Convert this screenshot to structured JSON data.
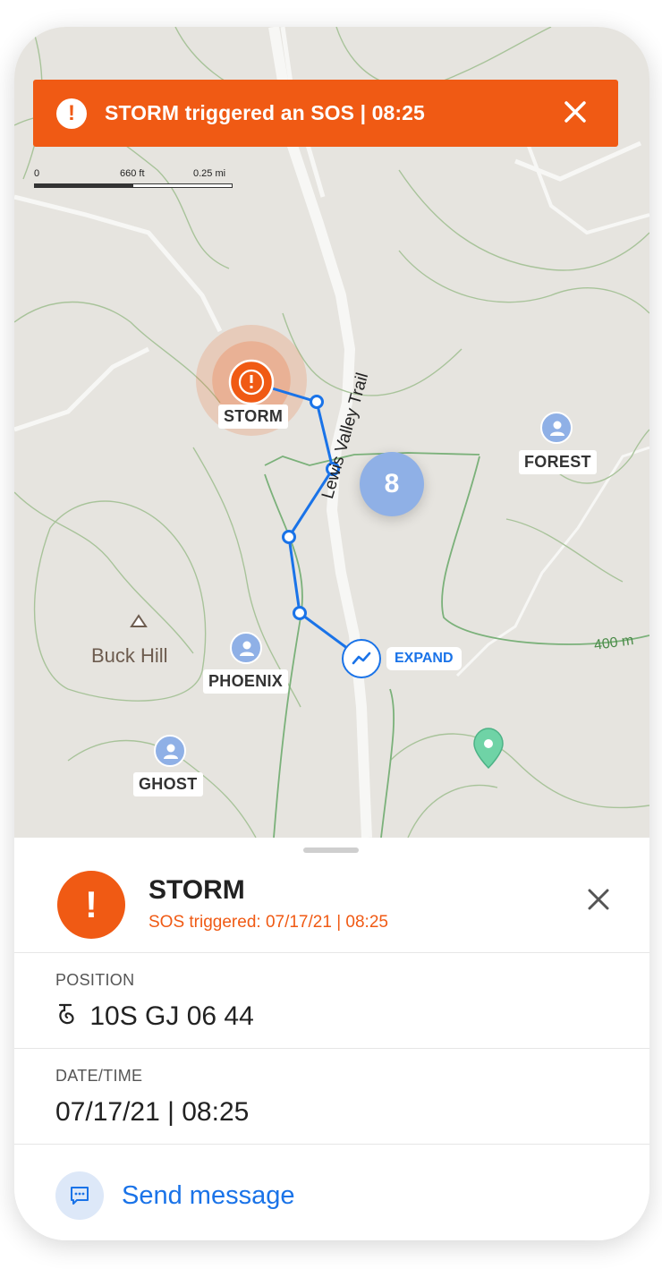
{
  "banner": {
    "text": "STORM triggered an SOS | 08:25",
    "icon": "alert-icon",
    "close_icon": "close-icon",
    "color": "#f05a14"
  },
  "scale_bar": {
    "start": "0",
    "mid": "660 ft",
    "end": "0.25 mi"
  },
  "map": {
    "trail_label": "Lewis Valley Trail",
    "peak_label": "Buck Hill",
    "contour_label": "400 m",
    "cluster_count": "8",
    "expand_label": "EXPAND",
    "markers": {
      "sos": "STORM",
      "users": [
        "FOREST",
        "PHOENIX",
        "GHOST"
      ]
    },
    "colors": {
      "route": "#1a73e8",
      "sos": "#f05a14",
      "user_pin": "#8fb0e6",
      "waypoint": "#6fd3a6"
    }
  },
  "sheet": {
    "title": "STORM",
    "subtitle": "SOS triggered: 07/17/21 | 08:25",
    "position_label": "POSITION",
    "position_value": "10S GJ 06 44",
    "datetime_label": "DATE/TIME",
    "datetime_value": "07/17/21 | 08:25",
    "send_label": "Send message"
  }
}
